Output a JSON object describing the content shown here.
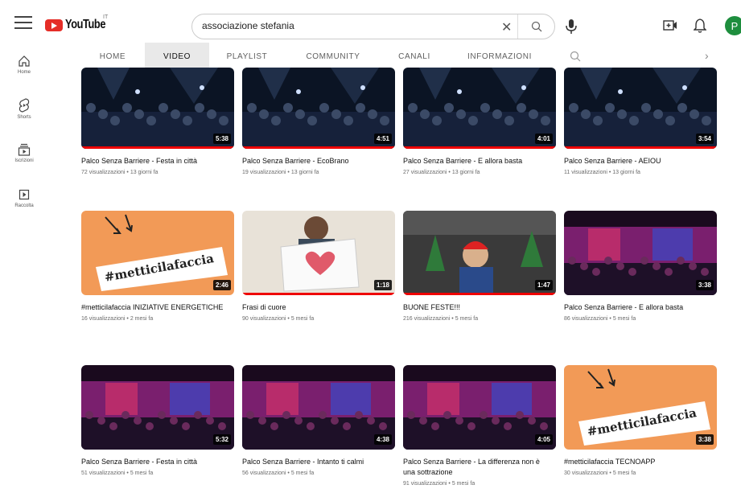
{
  "header": {
    "logo_text": "YouTube",
    "country_code": "IT",
    "search_value": "associazione stefania",
    "avatar_letter": "P",
    "colors": {
      "brand_red": "#e52d27",
      "avatar_green": "#1e8e3e",
      "progress_red": "#ee0000"
    }
  },
  "sidebar": {
    "items": [
      {
        "label": "Home",
        "icon": "home-icon"
      },
      {
        "label": "Shorts",
        "icon": "shorts-icon"
      },
      {
        "label": "Iscrizioni",
        "icon": "subscriptions-icon"
      },
      {
        "label": "Raccolta",
        "icon": "library-icon"
      }
    ]
  },
  "tabs": {
    "items": [
      {
        "label": "HOME"
      },
      {
        "label": "VIDEO",
        "active": true
      },
      {
        "label": "PLAYLIST"
      },
      {
        "label": "COMMUNITY"
      },
      {
        "label": "CANALI"
      },
      {
        "label": "INFORMAZIONI"
      }
    ]
  },
  "videos": [
    {
      "title": "Palco Senza Barriere - Festa in città",
      "meta": "72 visualizzazioni • 13 giorni fa",
      "duration": "5:38",
      "thumb": "concert-blue",
      "progress": 1.0
    },
    {
      "title": "Palco Senza Barriere - EcoBrano",
      "meta": "19 visualizzazioni • 13 giorni fa",
      "duration": "4:51",
      "thumb": "concert-blue",
      "progress": 1.0
    },
    {
      "title": "Palco Senza Barriere - E allora basta",
      "meta": "27 visualizzazioni • 13 giorni fa",
      "duration": "4:01",
      "thumb": "concert-blue",
      "progress": 1.0
    },
    {
      "title": "Palco Senza Barriere - AEIOU",
      "meta": "11 visualizzazioni • 13 giorni fa",
      "duration": "3:54",
      "thumb": "concert-blue",
      "progress": 1.0
    },
    {
      "title": "#metticilafaccia INIZIATIVE ENERGETICHE",
      "meta": "16 visualizzazioni • 2 mesi fa",
      "duration": "2:46",
      "thumb": "orange-banner",
      "banner_text": "#metticilafaccia",
      "progress": 0
    },
    {
      "title": "Frasi di cuore",
      "meta": "90 visualizzazioni • 5 mesi fa",
      "duration": "1:18",
      "thumb": "heart-sign",
      "progress": 1.0
    },
    {
      "title": "BUONE FESTE!!!",
      "meta": "216 visualizzazioni • 5 mesi fa",
      "duration": "1:47",
      "thumb": "christmas",
      "progress": 1.0
    },
    {
      "title": "Palco Senza Barriere - E allora basta",
      "meta": "86 visualizzazioni • 5 mesi fa",
      "duration": "3:38",
      "thumb": "concert-red",
      "progress": 0
    },
    {
      "title": "Palco Senza Barriere - Festa in città",
      "meta": "51 visualizzazioni • 5 mesi fa",
      "duration": "5:32",
      "thumb": "concert-red",
      "progress": 0
    },
    {
      "title": "Palco Senza Barriere - Intanto ti calmi",
      "meta": "56 visualizzazioni • 5 mesi fa",
      "duration": "4:38",
      "thumb": "concert-red",
      "progress": 0
    },
    {
      "title": "Palco Senza Barriere - La differenza non è una sottrazione",
      "meta": "91 visualizzazioni • 5 mesi fa",
      "duration": "4:05",
      "thumb": "concert-red",
      "progress": 0
    },
    {
      "title": "#metticilafaccia TECNOAPP",
      "meta": "30 visualizzazioni • 5 mesi fa",
      "duration": "3:38",
      "thumb": "orange-banner",
      "banner_text": "#metticilafaccia",
      "progress": 0
    }
  ]
}
